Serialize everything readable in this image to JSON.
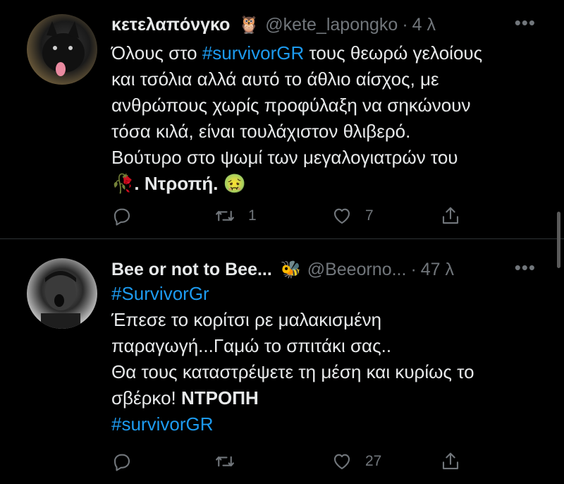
{
  "tweets": [
    {
      "name": "κετελαπόνγκο",
      "badge_emoji": "🦉",
      "handle": "@kete_lapongko",
      "dot": "·",
      "time": "4 λ",
      "more": "•••",
      "line1_text": "Όλους στο ",
      "line1_tag": "#survivorGR",
      "line1_rest": " τους θεωρώ γελοίους",
      "line2": "και τσόλια αλλά αυτό το άθλιο αίσχος, με",
      "line3": "ανθρώπους χωρίς προφύλαξη να σηκώνουν",
      "line4": "τόσα κιλά, είναι τουλάχιστον θλιβερό.",
      "line5": "Βούτυρο στο ψωμί των μεγαλογιατρών του",
      "line6_emoji": "🥀",
      "line6_bold": ". Ντροπή.",
      "line6_emoji2": "🤢",
      "replies": "",
      "retweets": "1",
      "likes": "7"
    },
    {
      "name": "Bee or not to Bee...",
      "badge_emoji": "🐝",
      "handle": "@Beeorno...",
      "dot": "·",
      "time": "47 λ",
      "more": "•••",
      "line1_tag": "#SurvivorGr",
      "line2": "Έπεσε το κορίτσι ρε μαλακισμένη",
      "line3": "παραγωγή...Γαμώ το σπιτάκι σας..",
      "line4": "Θα τους καταστρέψετε τη μέση και κυρίως το",
      "line5_text": "σβέρκο! ",
      "line5_bold": "ΝΤΡΟΠΗ",
      "line6_tag": "#survivorGR",
      "replies": "",
      "retweets": "",
      "likes": "27"
    }
  ],
  "icons": {
    "reply": "reply-icon",
    "retweet": "retweet-icon",
    "like": "like-icon",
    "share": "share-icon"
  }
}
